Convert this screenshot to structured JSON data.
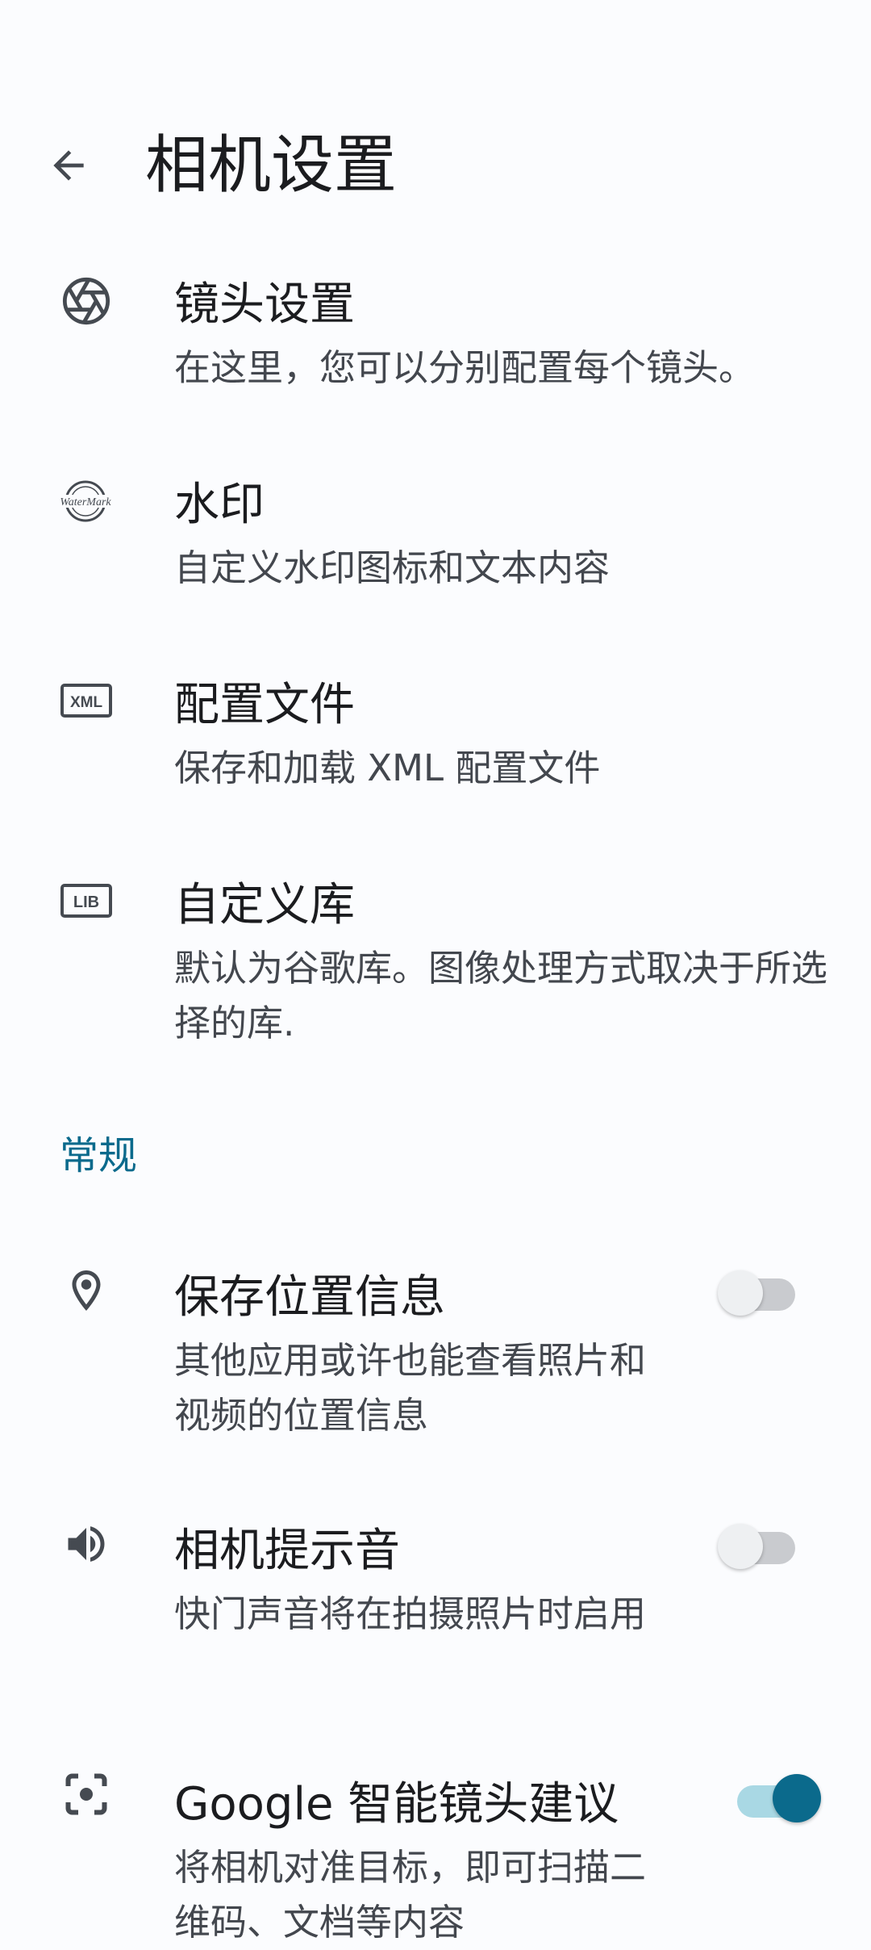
{
  "header": {
    "title": "相机设置"
  },
  "items": [
    {
      "icon": "shutter-aperture-icon",
      "title": "镜头设置",
      "summary": "在这里，您可以分别配置每个镜头。"
    },
    {
      "icon": "watermark-icon",
      "title": "水印",
      "summary": "自定义水印图标和文本内容"
    },
    {
      "icon": "xml-icon",
      "icon_label": "XML",
      "title": "配置文件",
      "summary": "保存和加载 XML 配置文件"
    },
    {
      "icon": "lib-icon",
      "icon_label": "LIB",
      "title": "自定义库",
      "summary": "默认为谷歌库。图像处理方式取决于所选择的库."
    }
  ],
  "section": {
    "label": "常规"
  },
  "toggles": [
    {
      "icon": "location-pin-icon",
      "title": "保存位置信息",
      "summary": "其他应用或许也能查看照片和视频的位置信息",
      "enabled": false
    },
    {
      "icon": "speaker-icon",
      "title": "相机提示音",
      "summary": "快门声音将在拍摄照片时启用",
      "enabled": false
    },
    {
      "icon": "lens-scan-icon",
      "title": "Google 智能镜头建议",
      "summary": "将相机对准目标，即可扫描二维码、文档等内容",
      "enabled": true
    }
  ],
  "colors": {
    "background": "#FBFCFE",
    "accent": "#0B6A8C",
    "icon": "#454A51"
  }
}
